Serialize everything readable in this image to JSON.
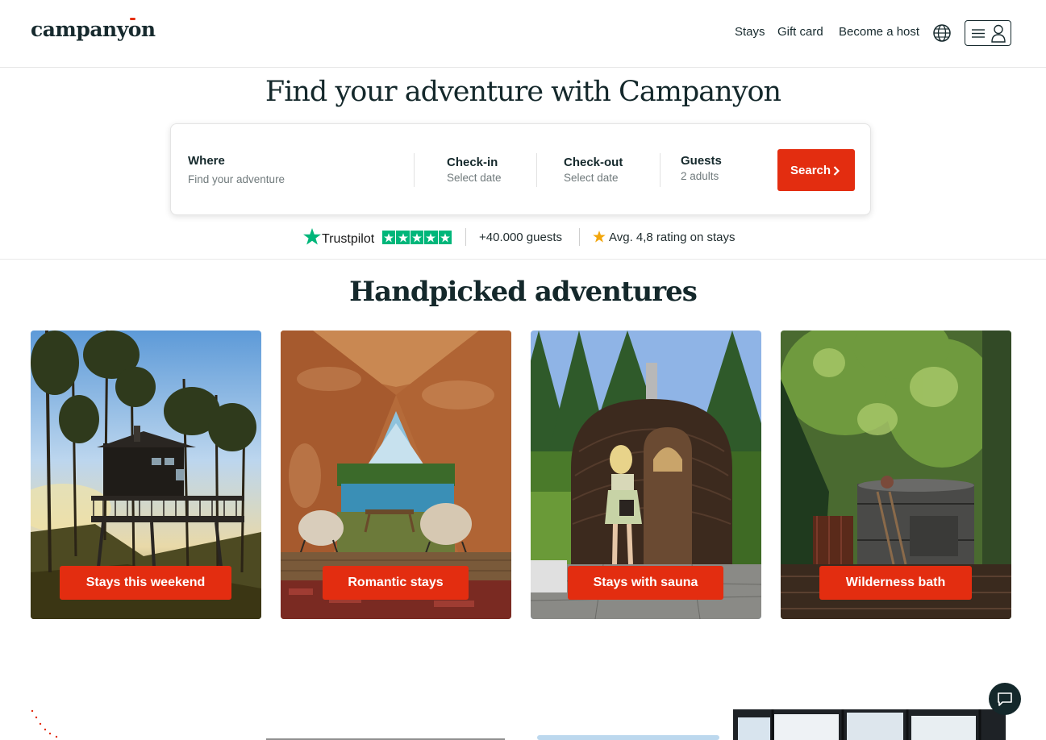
{
  "header": {
    "logo": "campanyon",
    "nav": [
      "Stays",
      "Gift card",
      "Become a host"
    ]
  },
  "hero": {
    "title": "Find your adventure with Campanyon"
  },
  "search": {
    "where_label": "Where",
    "where_placeholder": "Find your adventure",
    "checkin_label": "Check-in",
    "checkin_value": "Select date",
    "checkout_label": "Check-out",
    "checkout_value": "Select date",
    "guests_label": "Guests",
    "guests_value": "2 adults",
    "button_label": "Search"
  },
  "trust": {
    "trustpilot": "Trustpilot",
    "guests": "+40.000 guests",
    "rating": "Avg. 4,8 rating on stays"
  },
  "handpicked": {
    "title": "Handpicked adventures",
    "cards": [
      {
        "label": "Stays this weekend"
      },
      {
        "label": "Romantic stays"
      },
      {
        "label": "Stays with sauna"
      },
      {
        "label": "Wilderness bath"
      }
    ]
  },
  "colors": {
    "accent": "#e32d10",
    "text": "#14282b",
    "trustpilot_green": "#00b67a",
    "star_gold": "#f2a60c"
  }
}
